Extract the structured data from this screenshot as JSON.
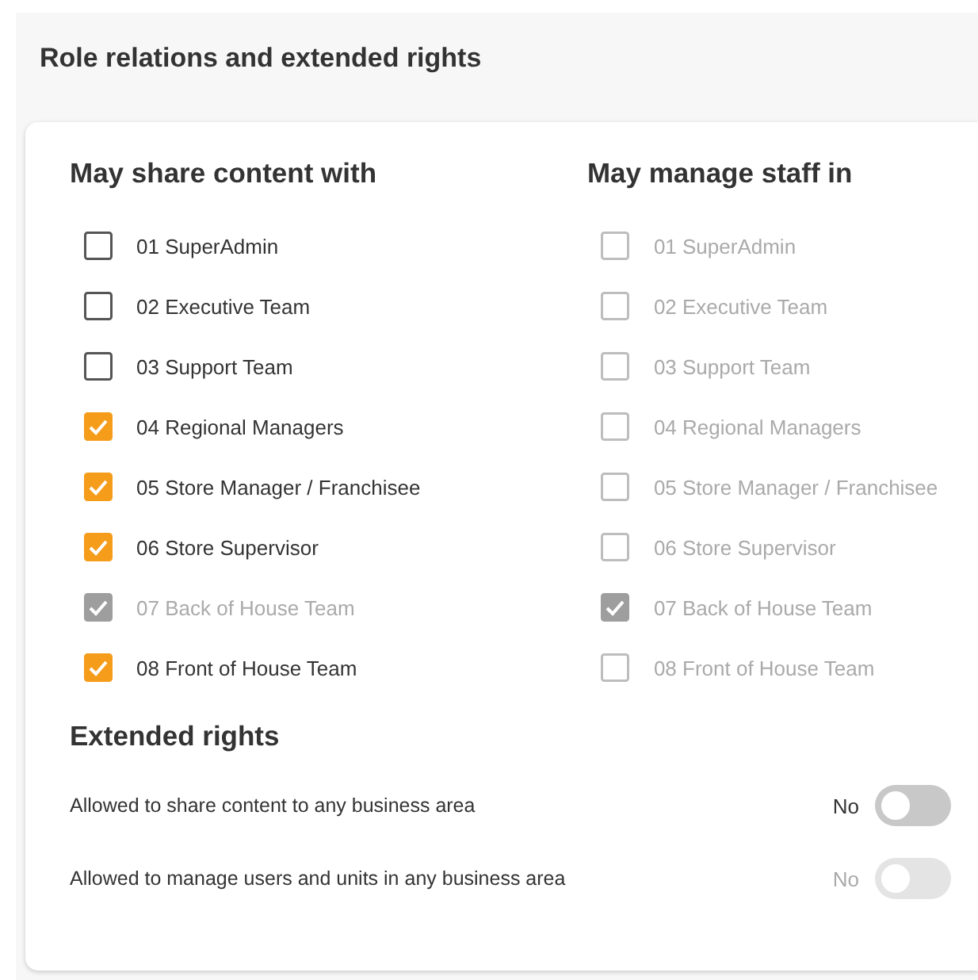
{
  "panel": {
    "title": "Role relations and extended rights"
  },
  "columns": [
    {
      "heading": "May share content with",
      "items": [
        {
          "label": "01 SuperAdmin",
          "checked": false,
          "disabled": false
        },
        {
          "label": "02 Executive Team",
          "checked": false,
          "disabled": false
        },
        {
          "label": "03 Support Team",
          "checked": false,
          "disabled": false
        },
        {
          "label": "04 Regional Managers",
          "checked": true,
          "disabled": false
        },
        {
          "label": "05 Store Manager / Franchisee",
          "checked": true,
          "disabled": false
        },
        {
          "label": "06 Store Supervisor",
          "checked": true,
          "disabled": false
        },
        {
          "label": "07 Back of House Team",
          "checked": true,
          "disabled": true
        },
        {
          "label": "08 Front of House Team",
          "checked": true,
          "disabled": false
        }
      ]
    },
    {
      "heading": "May manage staff in",
      "items": [
        {
          "label": "01 SuperAdmin",
          "checked": false,
          "disabled": true
        },
        {
          "label": "02 Executive Team",
          "checked": false,
          "disabled": true
        },
        {
          "label": "03 Support Team",
          "checked": false,
          "disabled": true
        },
        {
          "label": "04 Regional Managers",
          "checked": false,
          "disabled": true
        },
        {
          "label": "05 Store Manager / Franchisee",
          "checked": false,
          "disabled": true
        },
        {
          "label": "06 Store Supervisor",
          "checked": false,
          "disabled": true
        },
        {
          "label": "07 Back of House Team",
          "checked": true,
          "disabled": true
        },
        {
          "label": "08 Front of House Team",
          "checked": false,
          "disabled": true
        }
      ]
    }
  ],
  "extended_rights": {
    "heading": "Extended rights",
    "toggles": [
      {
        "label": "Allowed to share content to any business area",
        "value": "No",
        "on": false,
        "disabled": false
      },
      {
        "label": "Allowed to manage users and units in any business area",
        "value": "No",
        "on": false,
        "disabled": true
      }
    ]
  }
}
